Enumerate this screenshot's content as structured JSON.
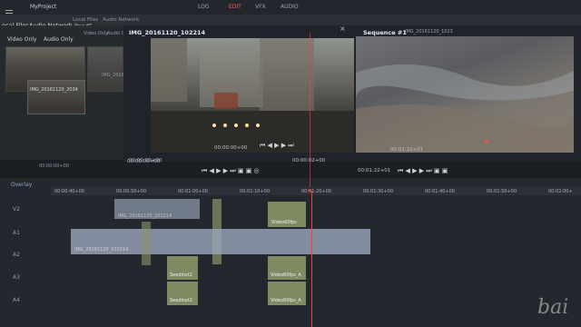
{
  "app": {
    "project": "MyProject"
  },
  "workspace_tabs": [
    {
      "label": "LOG",
      "active": false
    },
    {
      "label": "EDIT",
      "active": true
    },
    {
      "label": "VFX",
      "active": false
    },
    {
      "label": "AUDIO",
      "active": false
    }
  ],
  "browser": {
    "tabs": [
      "ocal Files",
      "Audio Network",
      "Local Files",
      "Audio Network",
      "Pond5"
    ],
    "filters": [
      "Video Only",
      "Audio Only",
      "Video Only",
      "Audio Only"
    ],
    "clip_label": "IMG_20161120_2034",
    "timecode": "00:00:00+00"
  },
  "source_viewer": {
    "title": "IMG_20161120_102214",
    "tc_left": "00:00:00+00",
    "tc_right": "00:00:02+00",
    "tc_bottom": "00:00:00+00"
  },
  "record_viewer": {
    "title": "Sequence #1",
    "ghost_title": "IMG_20161120_1023",
    "tc_mid": "00:01:22+01",
    "tc_bottom": "00:01:22+01"
  },
  "timeline": {
    "track_header": "Overlay",
    "ruler": [
      "00:00:40+00",
      "00:00:50+00",
      "00:01:00+00",
      "00:01:10+00",
      "00:01:20+00",
      "00:01:30+00",
      "00:01:40+00",
      "00:01:50+00",
      "00:02:00+"
    ],
    "tracks": [
      "V2",
      "A1",
      "A2",
      "A3",
      "A4"
    ],
    "clips": {
      "v2a": "IMG_20161120_102214",
      "v2b": "Video60fps",
      "a1": "IMG_20161120_102214",
      "a3a": "Seedinst2",
      "a3b": "Video60fps_A",
      "a4a": "Seedinst2",
      "a4b": "Video60fps_A"
    }
  },
  "watermark": "bai"
}
